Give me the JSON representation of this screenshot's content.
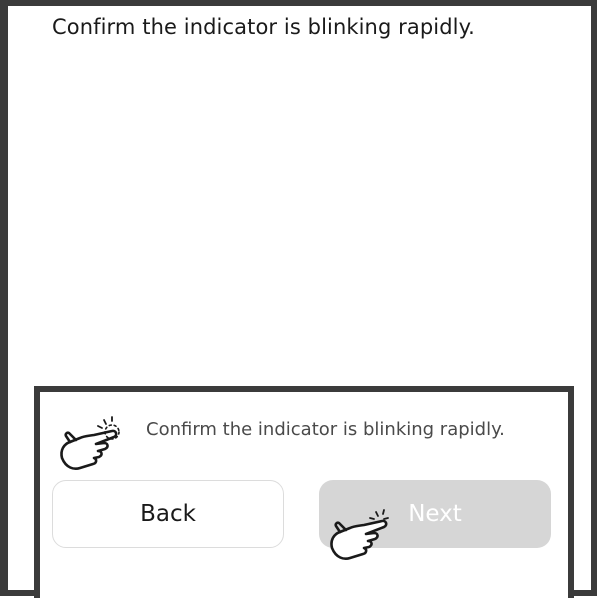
{
  "instruction_top": "Confirm the indicator is blinking rapidly.",
  "panel": {
    "hint": "Confirm the indicator is blinking rapidly.",
    "back_label": "Back",
    "next_label": "Next"
  },
  "icons": {
    "hint_pointer": "tap-hand-icon",
    "next_pointer": "tap-hand-icon"
  },
  "colors": {
    "frame": "#3b3b3b",
    "next_disabled_bg": "#d6d6d6",
    "back_border": "#dcdcdc"
  }
}
